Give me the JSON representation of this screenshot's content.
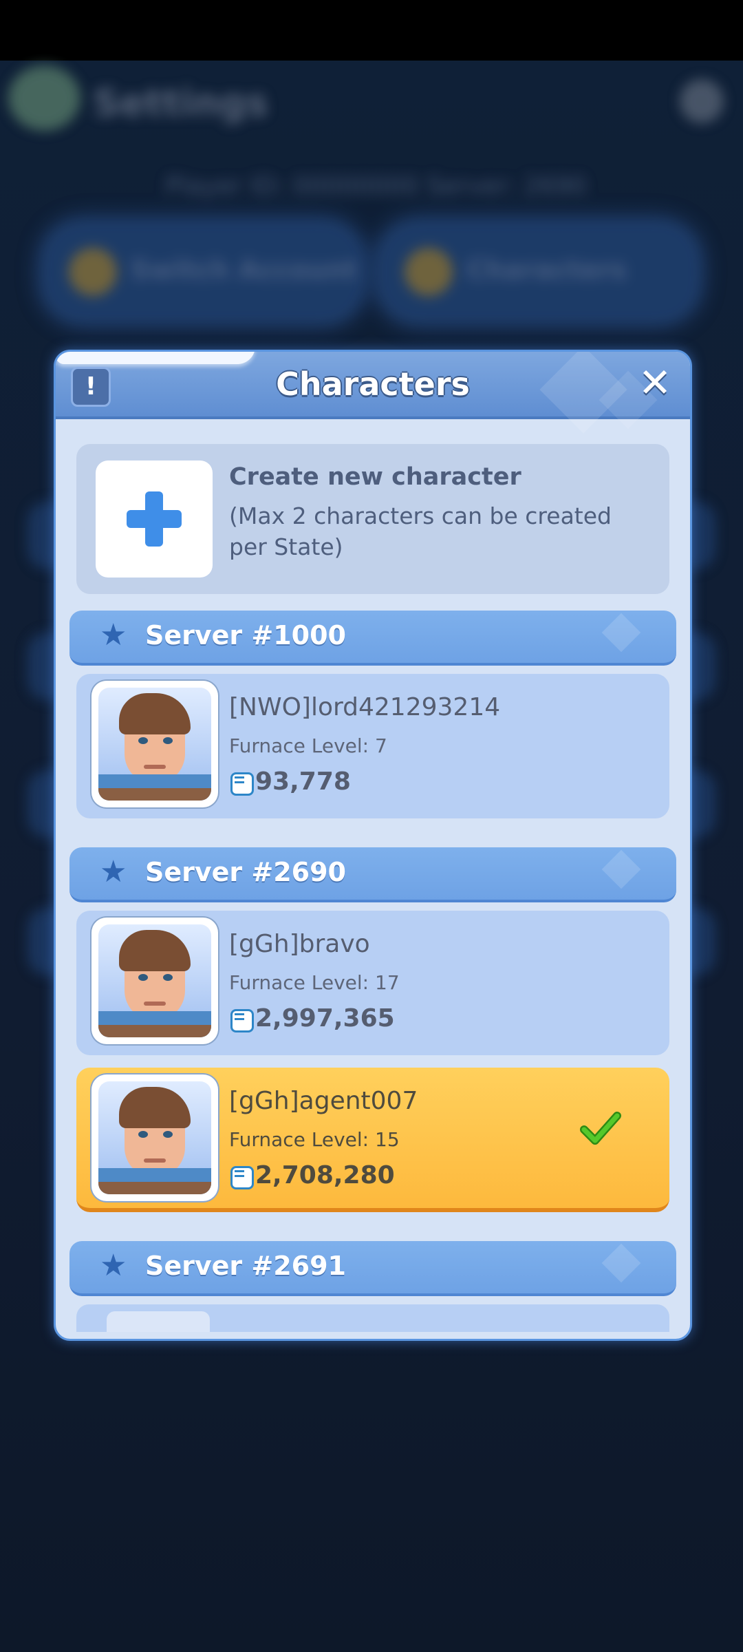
{
  "background": {
    "title": "Settings",
    "subtitle": "Player ID: 00000000  Server: 2690",
    "buttons": [
      "Switch Account",
      "Characters"
    ]
  },
  "modal": {
    "title": "Characters",
    "info_icon": "exclamation-icon",
    "close_icon": "close-icon",
    "create": {
      "title": "Create new character",
      "subtitle": "(Max 2 characters can be created per State)",
      "icon": "plus-icon"
    },
    "servers": [
      {
        "name": "Server #1000",
        "characters": [
          {
            "name": "[NWO]lord421293214",
            "furnace": "Furnace Level: 7",
            "power": "93,778",
            "selected": false
          }
        ]
      },
      {
        "name": "Server #2690",
        "characters": [
          {
            "name": "[gGh]bravo",
            "furnace": "Furnace Level: 17",
            "power": "2,997,365",
            "selected": false
          },
          {
            "name": "[gGh]agent007",
            "furnace": "Furnace Level: 15",
            "power": "2,708,280",
            "selected": true
          }
        ]
      },
      {
        "name": "Server #2691",
        "characters": []
      }
    ]
  },
  "colors": {
    "selected_card": "#fdb93d",
    "card": "#b7cff4",
    "server_bar": "#6ea2e5",
    "check": "#3fae1f"
  }
}
